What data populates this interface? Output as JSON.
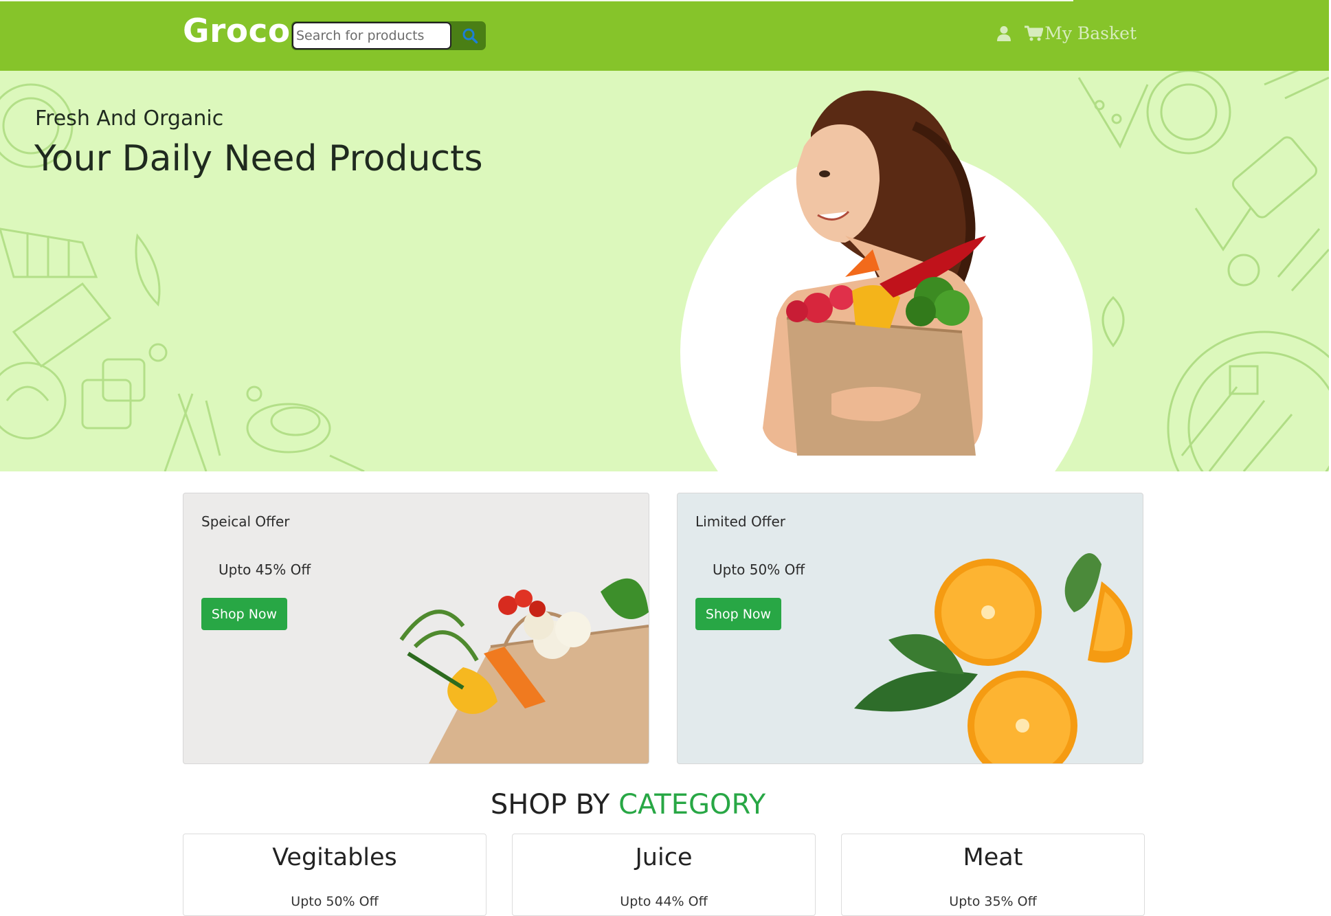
{
  "navbar": {
    "brand": "Groco",
    "search": {
      "placeholder": "Search for products",
      "value": ""
    },
    "icons": [
      "search-icon",
      "user-icon",
      "cart-icon"
    ],
    "cart_label": "My Basket"
  },
  "hero": {
    "subtitle": "Fresh And Organic",
    "title": "Your Daily Need Products"
  },
  "offers": [
    {
      "label": "Speical Offer",
      "discount": "Upto 45% Off",
      "button": "Shop Now"
    },
    {
      "label": "Limited Offer",
      "discount": "Upto 50% Off",
      "button": "Shop Now"
    }
  ],
  "category_section": {
    "heading_part1": "SHOP BY",
    "heading_part2": "CATEGORY",
    "items": [
      {
        "name": "Vegitables",
        "discount": "Upto 50% Off"
      },
      {
        "name": "Juice",
        "discount": "Upto 44% Off"
      },
      {
        "name": "Meat",
        "discount": "Upto 35% Off"
      }
    ]
  },
  "colors": {
    "navbar": "#86c42a",
    "hero_bg": "#dcf8bc",
    "accent_green": "#28a745",
    "search_button": "#4a7f15",
    "search_icon": "#1d7fd6"
  }
}
